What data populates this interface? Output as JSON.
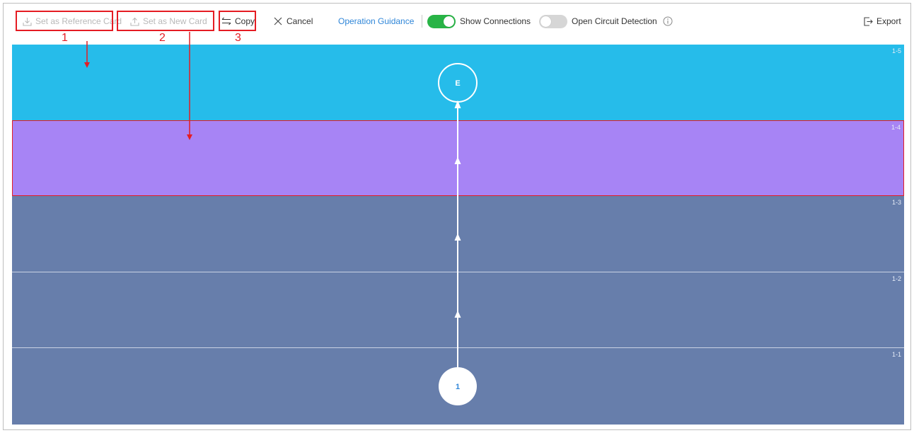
{
  "toolbar": {
    "set_reference": "Set as Reference Card",
    "set_new": "Set as New Card",
    "copy": "Copy",
    "cancel": "Cancel",
    "guidance": "Operation Guidance",
    "show_connections": "Show Connections",
    "show_connections_on": true,
    "open_circuit": "Open Circuit Detection",
    "open_circuit_on": false,
    "export": "Export"
  },
  "annotations": [
    "1",
    "2",
    "3"
  ],
  "bands": [
    {
      "label": "1-5",
      "color": "#26bcea"
    },
    {
      "label": "1-4",
      "color": "#a784f5",
      "selected": true
    },
    {
      "label": "1-3",
      "color": "#677eab"
    },
    {
      "label": "1-2",
      "color": "#677eab"
    },
    {
      "label": "1-1",
      "color": "#677eab"
    }
  ],
  "nodes": {
    "end": "E",
    "start": "1"
  },
  "colors": {
    "highlight": "#e51c23",
    "toggle_on": "#28b446",
    "link": "#2f86d8"
  }
}
